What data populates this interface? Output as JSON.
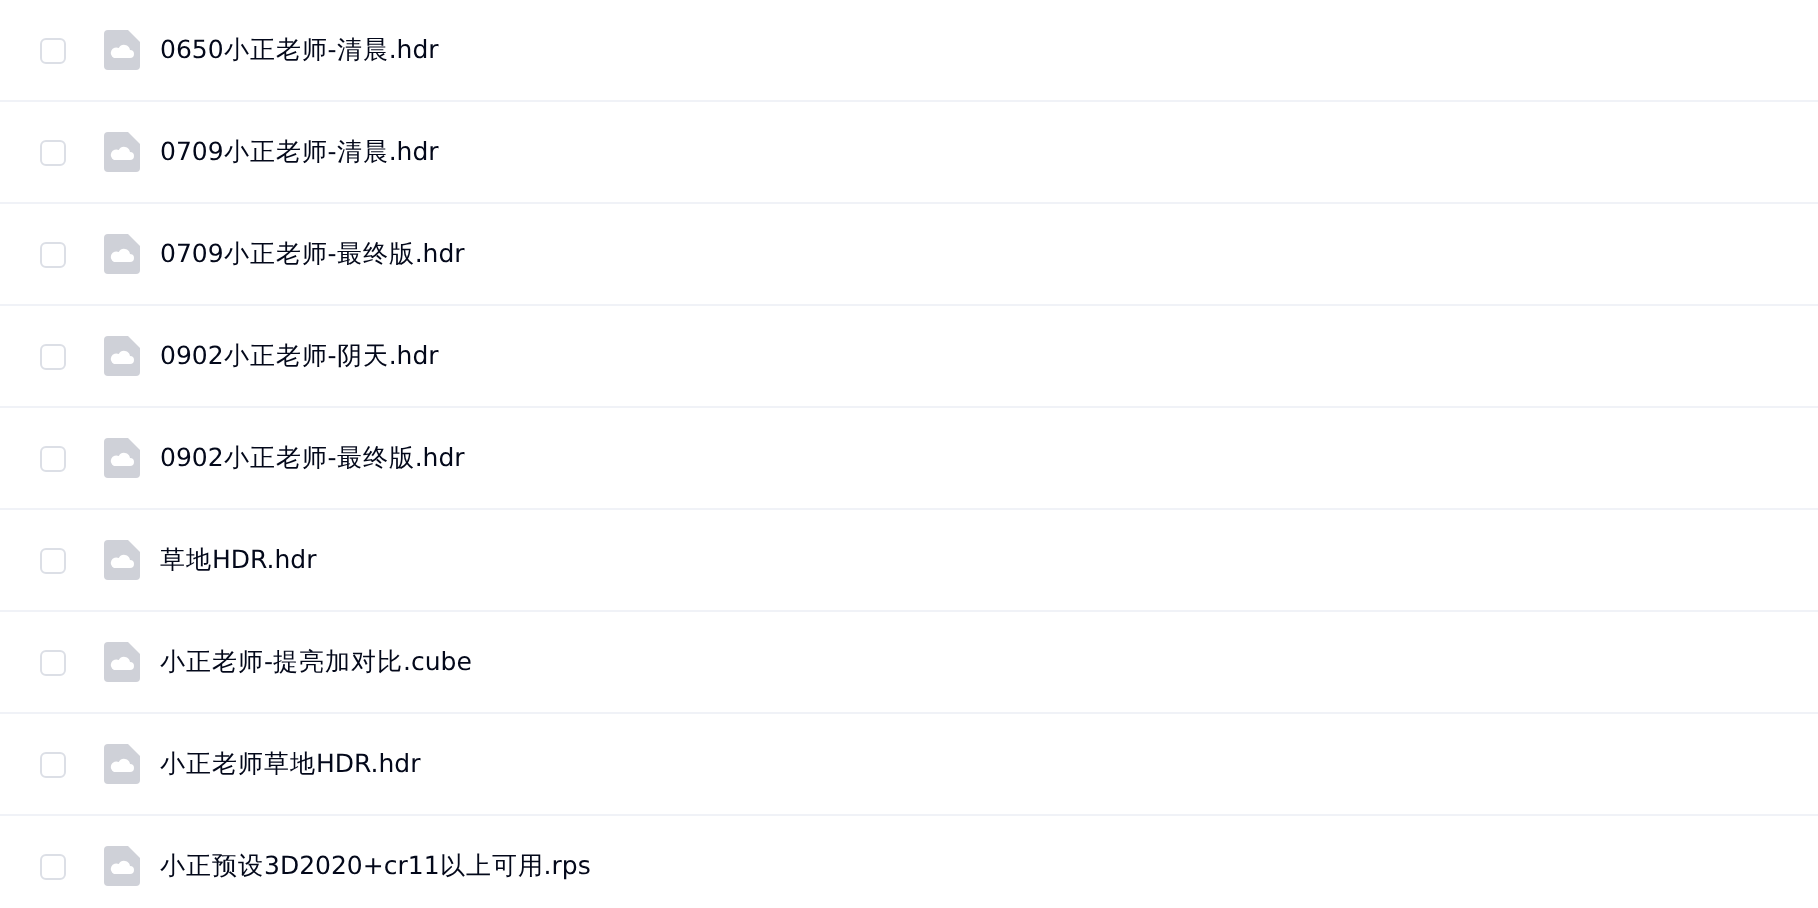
{
  "files": [
    {
      "name": "0650小正老师-清晨.hdr",
      "checked": false
    },
    {
      "name": "0709小正老师-清晨.hdr",
      "checked": false
    },
    {
      "name": "0709小正老师-最终版.hdr",
      "checked": false
    },
    {
      "name": "0902小正老师-阴天.hdr",
      "checked": false
    },
    {
      "name": "0902小正老师-最终版.hdr",
      "checked": false
    },
    {
      "name": "草地HDR.hdr",
      "checked": false
    },
    {
      "name": "小正老师-提亮加对比.cube",
      "checked": false
    },
    {
      "name": "小正老师草地HDR.hdr",
      "checked": false
    },
    {
      "name": "小正预设3D2020+cr11以上可用.rps",
      "checked": false
    }
  ]
}
